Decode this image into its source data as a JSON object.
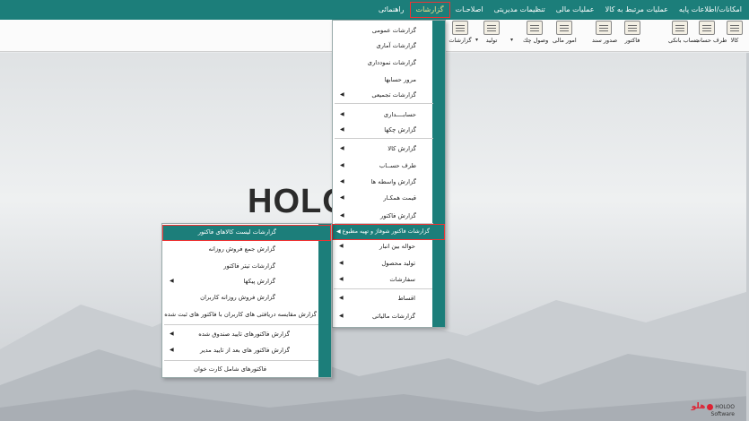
{
  "menubar": {
    "items": [
      {
        "label": "امکانات/اطلاعات پایه",
        "active": false
      },
      {
        "label": "عملیات مرتبط به کالا",
        "active": false
      },
      {
        "label": "عملیات مالی",
        "active": false
      },
      {
        "label": "تنظیمات مدیریتی",
        "active": false
      },
      {
        "label": "اصلاحـات",
        "active": false
      },
      {
        "label": "گزارشات",
        "active": true
      },
      {
        "label": "راهنمائی",
        "active": false
      }
    ]
  },
  "toolbar": {
    "buttons": [
      {
        "label": "کالا",
        "icon": "box-icon"
      },
      {
        "label": "طرف حساب",
        "icon": "person-icon"
      },
      {
        "label": "حساب بانکی",
        "icon": "bank-icon"
      },
      {
        "label": "فاکتور",
        "icon": "invoice-icon"
      },
      {
        "label": "صدور سند",
        "icon": "document-icon"
      },
      {
        "label": "امور مالی",
        "icon": "finance-icon"
      },
      {
        "label": "وصول چك",
        "icon": "check-icon"
      },
      {
        "label": "تولید",
        "icon": "factory-icon"
      },
      {
        "label": "گزارشات",
        "icon": "report-icon"
      }
    ]
  },
  "main_menu": {
    "items": [
      {
        "label": "گزارشات عمومی",
        "arrow": false
      },
      {
        "label": "گزارشات آماری",
        "arrow": false
      },
      {
        "label": "گزارشات نمودداری",
        "arrow": false
      },
      {
        "label": "مرور حسابها",
        "arrow": false
      },
      {
        "label": "گزارشات تجمیعی",
        "arrow": true
      },
      {
        "label": "حسابــــداری",
        "arrow": true
      },
      {
        "label": "گزارش چکها",
        "arrow": true
      },
      {
        "label": "گزارش کالا",
        "arrow": true
      },
      {
        "label": "طرف حســاب",
        "arrow": true
      },
      {
        "label": "گزارش واسطه ها",
        "arrow": true
      },
      {
        "label": "قیمت همکـار",
        "arrow": true
      },
      {
        "label": "گزارش فاکتور",
        "arrow": true
      },
      {
        "label": "گزارشات فاکتور شوفاژ و تهیه مطبوع",
        "arrow": true,
        "highlight": true
      },
      {
        "label": "حواله بین انبار",
        "arrow": true
      },
      {
        "label": "تولید محصول",
        "arrow": true
      },
      {
        "label": "سفارشات",
        "arrow": true
      },
      {
        "label": "اقساط",
        "arrow": true
      },
      {
        "label": "گزارشات مالیاتی",
        "arrow": true
      }
    ]
  },
  "sub_menu": {
    "items": [
      {
        "label": "گزارشات لیست کالاهای فاکتور",
        "arrow": false,
        "highlight": true
      },
      {
        "label": "گزارش جمع فروش روزانه",
        "arrow": false
      },
      {
        "label": "گزارشات تیتر فاکتور",
        "arrow": false
      },
      {
        "label": "گزارش پیکها",
        "arrow": true
      },
      {
        "label": "گزارش فروش روزانه کاربران",
        "arrow": false
      },
      {
        "label": "گزارش مقایسه دریافتی های کاربران با فاکتور های ثبت شده",
        "arrow": false
      },
      {
        "label": "گزارش فاکتورهای تایید صندوق شده",
        "arrow": true
      },
      {
        "label": "گزارش فاکتور های بعد از تایید مدیر",
        "arrow": true
      },
      {
        "label": "فاکتورهای شامل کارت خوان",
        "arrow": false
      }
    ]
  },
  "background": {
    "logo_text": "HOLO",
    "brand_fa": "هلو",
    "brand_en": "HOLOO",
    "brand_sub": "Software"
  },
  "colors": {
    "accent": "#1c7e7a",
    "highlight_border": "#e33333"
  }
}
